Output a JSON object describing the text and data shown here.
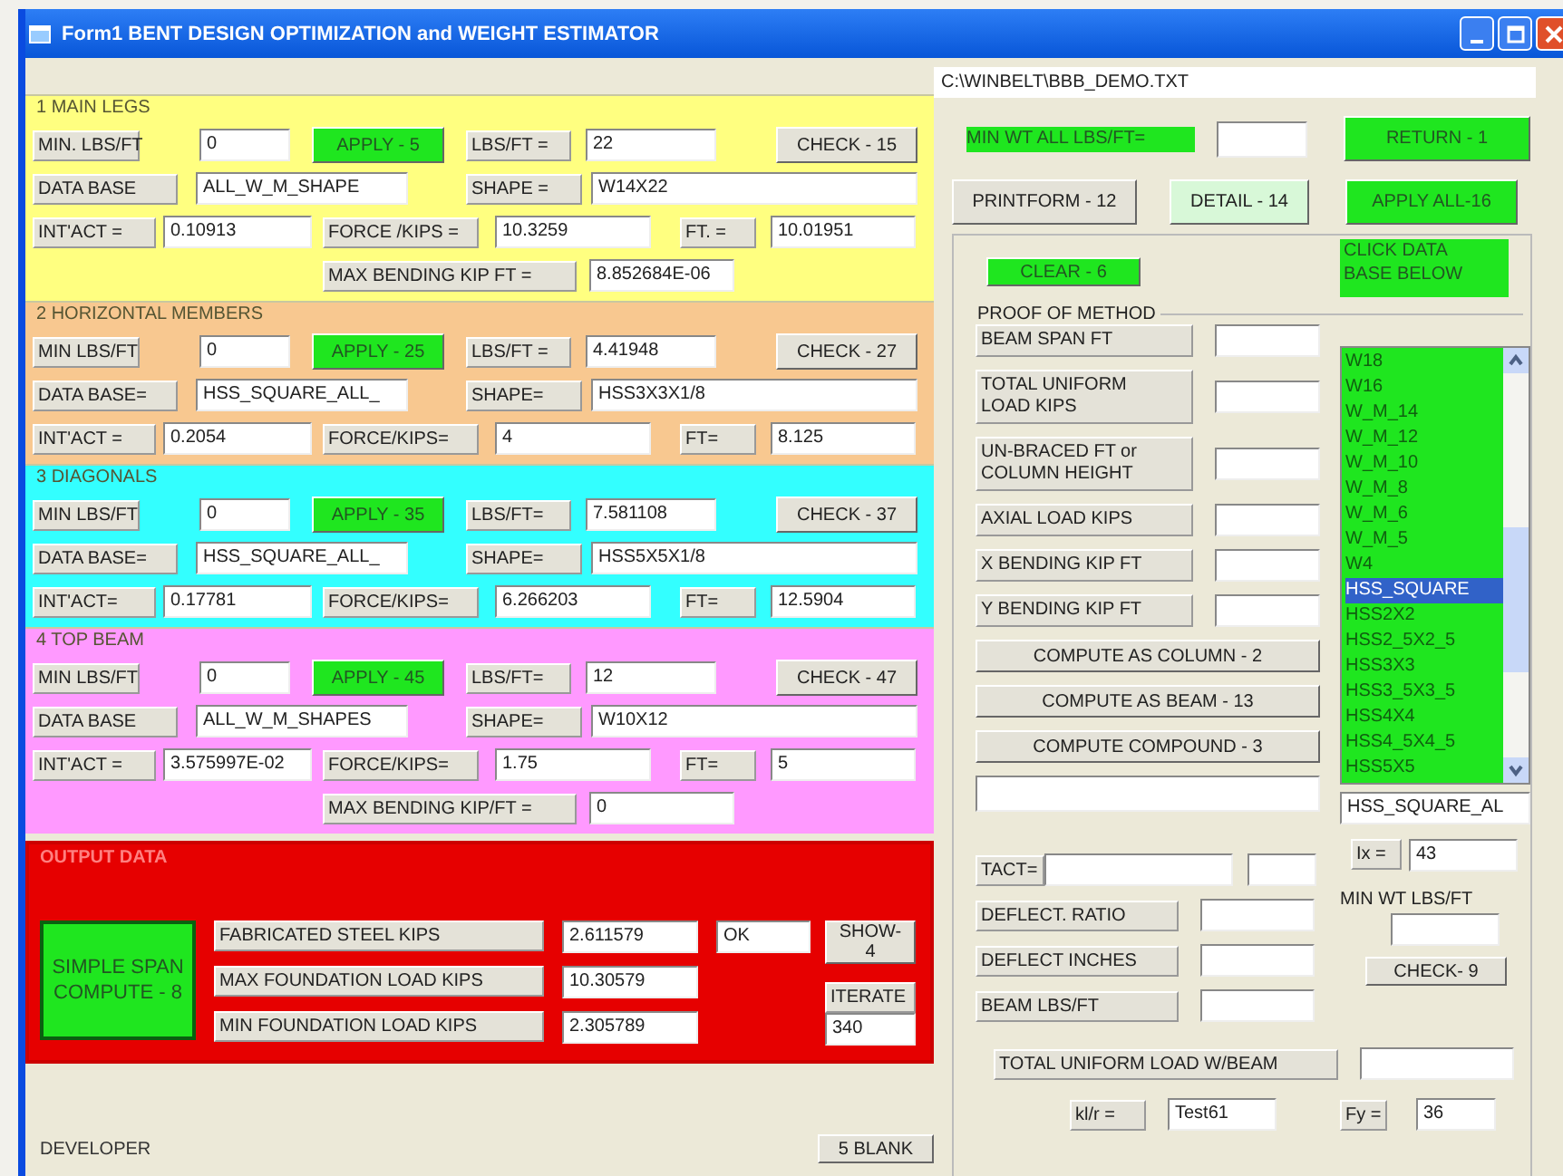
{
  "window": {
    "title": "Form1  BENT  DESIGN  OPTIMIZATION and  WEIGHT  ESTIMATOR"
  },
  "sections": [
    {
      "title": "1  MAIN LEGS",
      "color": "#ffff80",
      "rows": [
        [
          {
            "kind": "label",
            "text": "MIN. LBS/FT"
          },
          {
            "kind": "field",
            "value": "0"
          },
          {
            "kind": "action",
            "text": "APPLY - 5"
          },
          {
            "kind": "label",
            "text": "LBS/FT ="
          },
          {
            "kind": "field",
            "value": "22"
          },
          {
            "kind": "button",
            "text": "CHECK - 15"
          }
        ],
        [
          {
            "kind": "label",
            "text": "DATA BASE"
          },
          {
            "kind": "field",
            "value": "ALL_W_M_SHAPE"
          },
          {
            "kind": "blank"
          },
          {
            "kind": "label",
            "text": "SHAPE ="
          },
          {
            "kind": "field",
            "value": "W14X22"
          }
        ],
        [
          {
            "kind": "label",
            "text": "INT'ACT ="
          },
          {
            "kind": "field",
            "value": "0.10913"
          },
          {
            "kind": "label",
            "text": "FORCE /KIPS ="
          },
          {
            "kind": "field",
            "value": "10.3259"
          },
          {
            "kind": "label",
            "text": "FT. ="
          },
          {
            "kind": "field",
            "value": "10.01951"
          }
        ],
        [
          {
            "kind": "blank"
          },
          {
            "kind": "blank"
          },
          {
            "kind": "label",
            "text": "MAX BENDING KIP FT ="
          },
          {
            "kind": "blank"
          },
          {
            "kind": "field",
            "value": "8.852684E-06"
          }
        ]
      ]
    },
    {
      "title": "2  HORIZONTAL MEMBERS",
      "color": "#f8c890",
      "rows": [
        [
          {
            "kind": "label",
            "text": "MIN LBS/FT"
          },
          {
            "kind": "field",
            "value": "0"
          },
          {
            "kind": "action",
            "text": "APPLY - 25"
          },
          {
            "kind": "label",
            "text": "LBS/FT ="
          },
          {
            "kind": "field",
            "value": "4.41948"
          },
          {
            "kind": "button",
            "text": "CHECK - 27"
          }
        ],
        [
          {
            "kind": "label",
            "text": "DATA BASE="
          },
          {
            "kind": "field",
            "value": "HSS_SQUARE_ALL_"
          },
          {
            "kind": "blank"
          },
          {
            "kind": "label",
            "text": "SHAPE="
          },
          {
            "kind": "field",
            "value": "HSS3X3X1/8"
          }
        ],
        [
          {
            "kind": "label",
            "text": "INT'ACT ="
          },
          {
            "kind": "field",
            "value": "0.2054"
          },
          {
            "kind": "label",
            "text": "FORCE/KIPS="
          },
          {
            "kind": "field",
            "value": "4"
          },
          {
            "kind": "label",
            "text": "FT="
          },
          {
            "kind": "field",
            "value": "8.125"
          }
        ]
      ]
    },
    {
      "title": "3  DIAGONALS",
      "color": "#33ffff",
      "rows": [
        [
          {
            "kind": "label",
            "text": "MIN LBS/FT"
          },
          {
            "kind": "field",
            "value": "0"
          },
          {
            "kind": "action",
            "text": "APPLY - 35"
          },
          {
            "kind": "label",
            "text": "LBS/FT="
          },
          {
            "kind": "field",
            "value": "7.581108"
          },
          {
            "kind": "button",
            "text": "CHECK - 37"
          }
        ],
        [
          {
            "kind": "label",
            "text": "DATA BASE="
          },
          {
            "kind": "field",
            "value": "HSS_SQUARE_ALL_"
          },
          {
            "kind": "blank"
          },
          {
            "kind": "label",
            "text": "SHAPE="
          },
          {
            "kind": "field",
            "value": "HSS5X5X1/8"
          }
        ],
        [
          {
            "kind": "label",
            "text": "INT'ACT="
          },
          {
            "kind": "field",
            "value": "0.17781"
          },
          {
            "kind": "label",
            "text": "FORCE/KIPS="
          },
          {
            "kind": "field",
            "value": "6.266203"
          },
          {
            "kind": "label",
            "text": "FT="
          },
          {
            "kind": "field",
            "value": "12.5904"
          }
        ]
      ]
    },
    {
      "title": "4  TOP BEAM",
      "color": "#ff99ff",
      "rows": [
        [
          {
            "kind": "label",
            "text": "MIN LBS/FT"
          },
          {
            "kind": "field",
            "value": "0"
          },
          {
            "kind": "action",
            "text": "APPLY - 45"
          },
          {
            "kind": "label",
            "text": "LBS/FT="
          },
          {
            "kind": "field",
            "value": "12"
          },
          {
            "kind": "button",
            "text": "CHECK - 47"
          }
        ],
        [
          {
            "kind": "label",
            "text": "DATA BASE"
          },
          {
            "kind": "field",
            "value": "ALL_W_M_SHAPES"
          },
          {
            "kind": "blank"
          },
          {
            "kind": "label",
            "text": "SHAPE="
          },
          {
            "kind": "field",
            "value": "W10X12"
          }
        ],
        [
          {
            "kind": "label",
            "text": "INT'ACT ="
          },
          {
            "kind": "field",
            "value": "3.575997E-02"
          },
          {
            "kind": "label",
            "text": "FORCE/KIPS="
          },
          {
            "kind": "field",
            "value": "1.75"
          },
          {
            "kind": "label",
            "text": "FT="
          },
          {
            "kind": "field",
            "value": "5"
          }
        ],
        [
          {
            "kind": "blank"
          },
          {
            "kind": "blank"
          },
          {
            "kind": "label",
            "text": "MAX BENDING KIP/FT ="
          },
          {
            "kind": "blank"
          },
          {
            "kind": "field",
            "value": "0"
          }
        ]
      ]
    }
  ],
  "output": {
    "title": "OUTPUT DATA",
    "compute_button": "SIMPLE SPAN\nCOMPUTE - 8",
    "results": [
      {
        "label": "FABRICATED  STEEL KIPS",
        "value": "2.611579"
      },
      {
        "label": "MAX FOUNDATION LOAD  KIPS",
        "value": "10.30579"
      },
      {
        "label": "MIN FOUNDATION LOAD  KIPS",
        "value": "2.305789"
      }
    ],
    "status": "OK",
    "show_button": "SHOW-\n4",
    "iterate_label": "ITERATE",
    "iterations": "340"
  },
  "developer": "DEVELOPER",
  "blank_button": "5 BLANK",
  "file_path": "C:\\WINBELT\\BBB_DEMO.TXT",
  "min_wt_all": {
    "label": "MIN WT ALL LBS/FT="
  },
  "return_button": "RETURN - 1",
  "printform_button": "PRINTFORM - 12",
  "detail_button": "DETAIL - 14",
  "apply_all_button": "APPLY ALL-16",
  "clear_button": "CLEAR - 6",
  "hint": "CLICK DATA\nBASE BELOW",
  "proof": {
    "title": "PROOF OF METHOD",
    "inputs": [
      {
        "label": "BEAM SPAN FT"
      },
      {
        "label": "TOTAL UNIFORM\nLOAD KIPS"
      },
      {
        "label": "UN-BRACED FT  or\nCOLUMN HEIGHT"
      },
      {
        "label": "AXIAL LOAD KIPS"
      },
      {
        "label": "X BENDING KIP FT"
      },
      {
        "label": "Y BENDING KIP FT"
      }
    ],
    "buttons": [
      "COMPUTE AS COLUMN - 2",
      "COMPUTE AS BEAM - 13",
      "COMPUTE COMPOUND - 3"
    ]
  },
  "database_list": {
    "items": [
      {
        "text": "W18",
        "selected": false
      },
      {
        "text": "W16",
        "selected": false
      },
      {
        "text": "W_M_14",
        "selected": false
      },
      {
        "text": "W_M_12",
        "selected": false
      },
      {
        "text": "W_M_10",
        "selected": false
      },
      {
        "text": "W_M_8",
        "selected": false
      },
      {
        "text": "W_M_6",
        "selected": false
      },
      {
        "text": "W_M_5",
        "selected": false
      },
      {
        "text": "W4",
        "selected": false
      },
      {
        "text": "HSS_SQUARE",
        "selected": true
      },
      {
        "text": "HSS2X2",
        "selected": false
      },
      {
        "text": "HSS2_5X2_5",
        "selected": false
      },
      {
        "text": "HSS3X3",
        "selected": false
      },
      {
        "text": "HSS3_5X3_5",
        "selected": false
      },
      {
        "text": "HSS4X4",
        "selected": false
      },
      {
        "text": "HSS4_5X4_5",
        "selected": false
      },
      {
        "text": "HSS5X5",
        "selected": false
      }
    ],
    "value": "HSS_SQUARE_AL"
  },
  "ix": {
    "label": "Ix =",
    "value": "43"
  },
  "tact": {
    "label": "TACT="
  },
  "min_wt": {
    "label": "MIN WT LBS/FT"
  },
  "check_button": "CHECK- 9",
  "results": [
    {
      "label": "DEFLECT.  RATIO"
    },
    {
      "label": "DEFLECT INCHES"
    },
    {
      "label": "BEAM LBS/FT"
    }
  ],
  "total_load": {
    "label": "TOTAL UNIFORM LOAD  W/BEAM"
  },
  "klr": {
    "label": "kl/r =",
    "value": "Test61"
  },
  "fy": {
    "label": "Fy =",
    "value": "36"
  }
}
